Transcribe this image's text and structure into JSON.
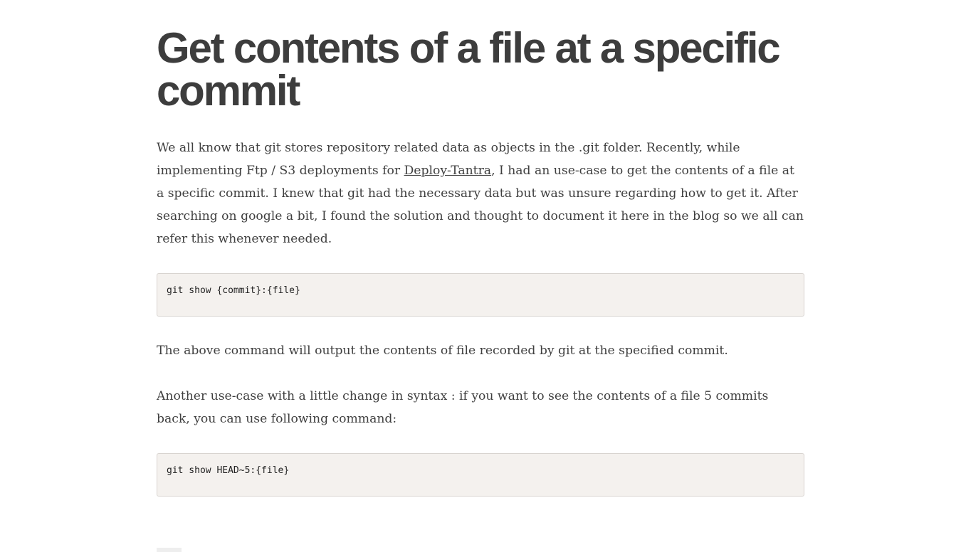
{
  "article": {
    "title": "Get contents of a file at a specific commit",
    "intro_before_link": "We all know that git stores repository related data as objects in the .git folder. Recently, while implementing Ftp / S3 deployments for ",
    "intro_link": "Deploy-Tantra",
    "intro_after_link": ", I had an use-case to get the contents of a file at a specific commit. I knew that git had the necessary data but was unsure regarding how to get it. After searching on google a bit, I found the solution and thought to document it here in the blog so we all can refer this whenever needed.",
    "code1": "git show {commit}:{file}",
    "para2": "The above command will output the contents of file recorded by git at the specified commit.",
    "para3": "Another use-case with a little change in syntax : if you want to see the contents of a file 5 commits back, you can use following command:",
    "code2": "git show HEAD~5:{file}"
  }
}
